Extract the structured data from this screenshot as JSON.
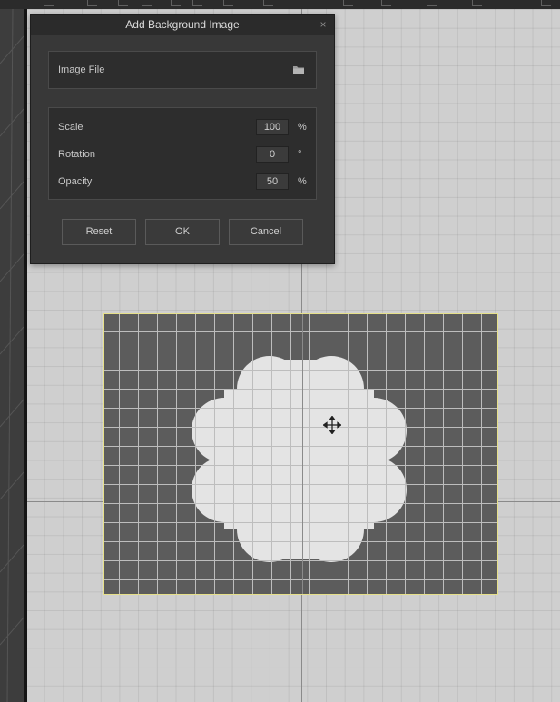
{
  "dialog": {
    "title": "Add Background Image",
    "close_symbol": "×",
    "image_file_label": "Image File",
    "folder_icon": "folder-icon",
    "fields": [
      {
        "label": "Scale",
        "value": "100",
        "unit": "%"
      },
      {
        "label": "Rotation",
        "value": "0",
        "unit": "°"
      },
      {
        "label": "Opacity",
        "value": "50",
        "unit": "%"
      }
    ],
    "buttons": {
      "reset": "Reset",
      "ok": "OK",
      "cancel": "Cancel"
    }
  },
  "viewport": {
    "cursor_icon": "move-cursor-icon",
    "frame_border_color": "#e6e08a"
  }
}
